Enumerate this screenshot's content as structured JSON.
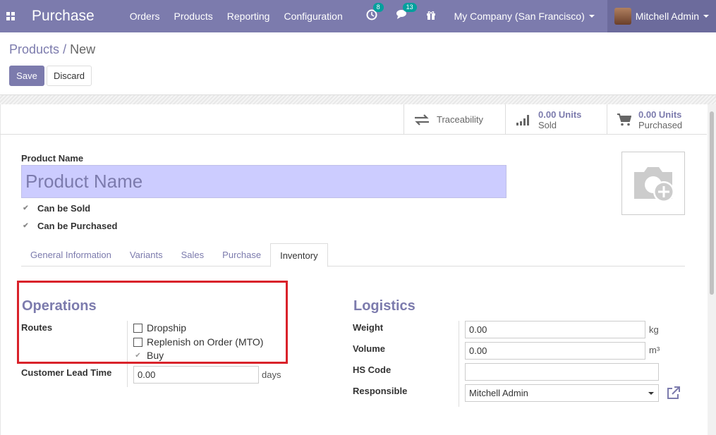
{
  "navbar": {
    "brand": "Purchase",
    "menu": [
      "Orders",
      "Products",
      "Reporting",
      "Configuration"
    ],
    "activity_count": "8",
    "messages_count": "13",
    "company": "My Company (San Francisco)",
    "user": "Mitchell Admin"
  },
  "breadcrumb": {
    "parent": "Products",
    "separator": "/",
    "current": "New"
  },
  "buttons": {
    "save": "Save",
    "discard": "Discard"
  },
  "smart_buttons": {
    "traceability": "Traceability",
    "sold_value": "0.00 Units",
    "sold_label": "Sold",
    "purchased_value": "0.00 Units",
    "purchased_label": "Purchased"
  },
  "form": {
    "product_name_label": "Product Name",
    "product_name_placeholder": "Product Name",
    "can_be_sold": "Can be Sold",
    "can_be_purchased": "Can be Purchased"
  },
  "tabs": [
    "General Information",
    "Variants",
    "Sales",
    "Purchase",
    "Inventory"
  ],
  "operations": {
    "title": "Operations",
    "routes_label": "Routes",
    "routes": [
      "Dropship",
      "Replenish on Order (MTO)",
      "Buy"
    ],
    "lead_time_label": "Customer Lead Time",
    "lead_time_value": "0.00",
    "lead_time_unit": "days"
  },
  "logistics": {
    "title": "Logistics",
    "weight_label": "Weight",
    "weight_value": "0.00",
    "weight_unit": "kg",
    "volume_label": "Volume",
    "volume_value": "0.00",
    "volume_unit": "m³",
    "hs_code_label": "HS Code",
    "hs_code_value": "",
    "responsible_label": "Responsible",
    "responsible_value": "Mitchell Admin"
  },
  "colors": {
    "primary": "#7c7bad",
    "highlight": "#d9222a",
    "badge": "#00a09d"
  }
}
